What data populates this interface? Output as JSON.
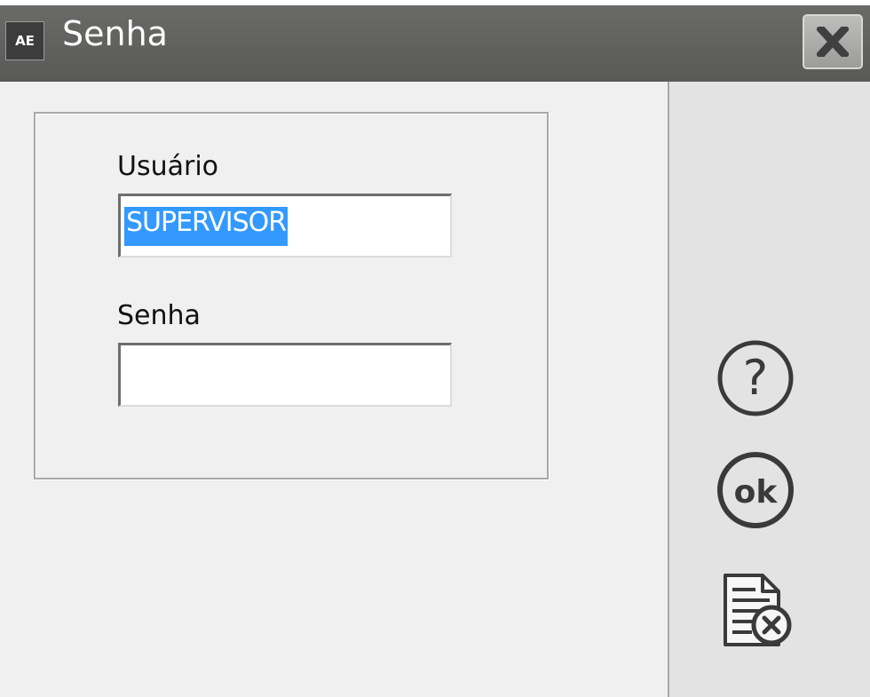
{
  "window": {
    "icon_text": "AE",
    "title": "Senha"
  },
  "form": {
    "user_label": "Usuário",
    "user_value": "SUPERVISOR",
    "password_label": "Senha",
    "password_value": ""
  },
  "side_buttons": [
    {
      "name": "help",
      "icon": "question-circle-icon",
      "text": "?"
    },
    {
      "name": "ok",
      "icon": "ok-circle-icon",
      "text": "ok"
    },
    {
      "name": "cancel",
      "icon": "document-cancel-icon"
    }
  ]
}
